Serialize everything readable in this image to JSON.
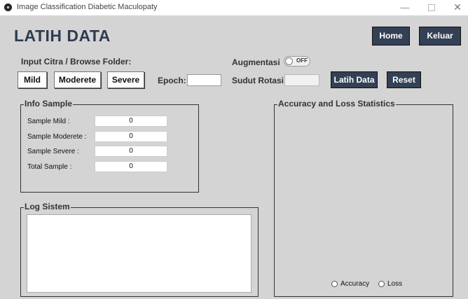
{
  "window": {
    "title": "Image Classification Diabetic Maculopaty",
    "minimize": "—",
    "close": "✕"
  },
  "page": {
    "title": "LATIH DATA"
  },
  "header_buttons": {
    "home": "Home",
    "keluar": "Keluar"
  },
  "input_section": {
    "label": "Input Citra / Browse Folder:",
    "mild": "Mild",
    "moderete": "Moderete",
    "severe": "Severe",
    "epoch_label": "Epoch:",
    "epoch_value": ""
  },
  "augmentation": {
    "label": "Augmentasi",
    "toggle_state": "OFF",
    "rotation_label": "Sudut Rotasi:",
    "rotation_value": "",
    "train_button": "Latih Data",
    "reset_button": "Reset"
  },
  "info_sample": {
    "title": "Info Sample",
    "rows": [
      {
        "label": "Sample Mild :",
        "value": "0"
      },
      {
        "label": "Sample Moderete :",
        "value": "0"
      },
      {
        "label": "Sample Severe :",
        "value": "0"
      },
      {
        "label": "Total Sample :",
        "value": "0"
      }
    ]
  },
  "log": {
    "title": "Log Sistem",
    "content": ""
  },
  "stats": {
    "title": "Accuracy and Loss Statistics",
    "options": [
      "Accuracy",
      "Loss"
    ]
  }
}
